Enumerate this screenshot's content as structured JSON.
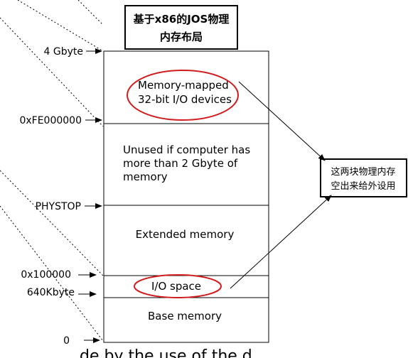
{
  "title": {
    "line1": "基于x86的JOS物理",
    "line2": "内存布局"
  },
  "address_labels": {
    "top": "4 Gbyte",
    "fe000000": "0xFE000000",
    "phystop": "PHYSTOP",
    "x100000": "0x100000",
    "k640": "640Kbyte",
    "zero": "0"
  },
  "regions": {
    "mmio_line1": "Memory-mapped",
    "mmio_line2": "32-bit I/O devices",
    "unused_line1": "Unused if computer has",
    "unused_line2": "more than 2 Gbyte of",
    "unused_line3": "memory",
    "extended": "Extended memory",
    "io_space": "I/O space",
    "base": "Base memory"
  },
  "note": {
    "line1": "这两块物理内存",
    "line2": "空出来给外设用"
  },
  "bottom_caption": "de by the use of the d",
  "colors": {
    "highlight": "#d01c1c",
    "stroke": "#000000"
  }
}
